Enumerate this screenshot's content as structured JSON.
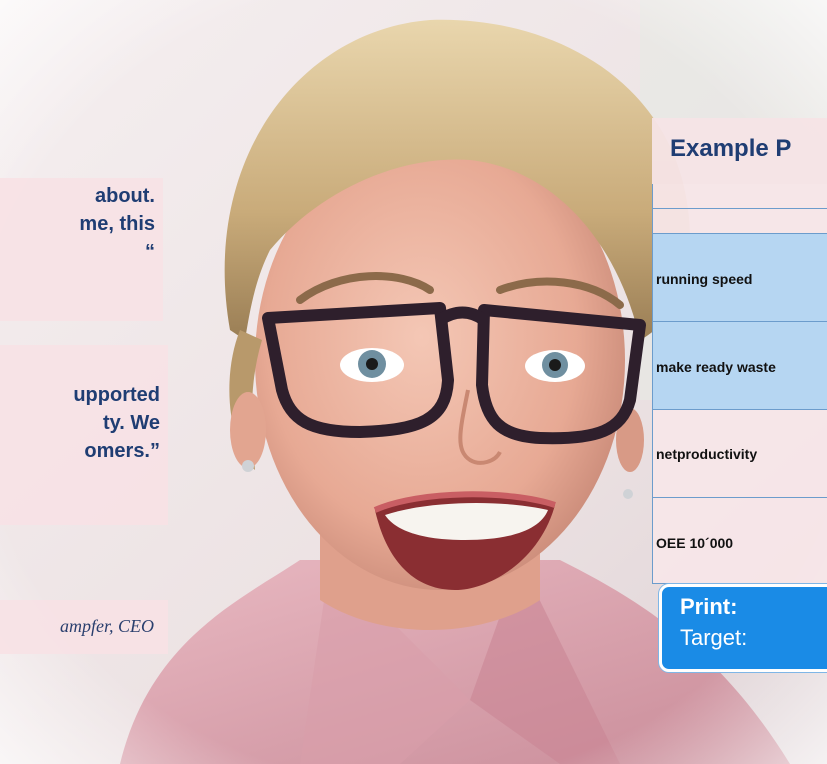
{
  "quotes": [
    {
      "lines": [
        "about.",
        "me, this",
        "“"
      ]
    },
    {
      "lines": [
        "upported",
        "ty. We",
        "omers.”"
      ]
    }
  ],
  "author": "ampfer, CEO",
  "panel": {
    "title": "Example P",
    "rows": [
      {
        "label": "",
        "color": "blank"
      },
      {
        "label": "",
        "color": "blank"
      },
      {
        "label": "running speed",
        "color": "blue"
      },
      {
        "label": "make ready waste",
        "color": "blue"
      },
      {
        "label": "netproductivity",
        "color": "pink"
      },
      {
        "label": "OEE 10´000",
        "color": "pink"
      }
    ]
  },
  "print_box": {
    "print_label": "Print:",
    "target_label": "Target:"
  },
  "colors": {
    "quote_text": "#1f3d73",
    "panel_blue": "#b6d6f2",
    "print_box_blue": "#1a8be6"
  }
}
